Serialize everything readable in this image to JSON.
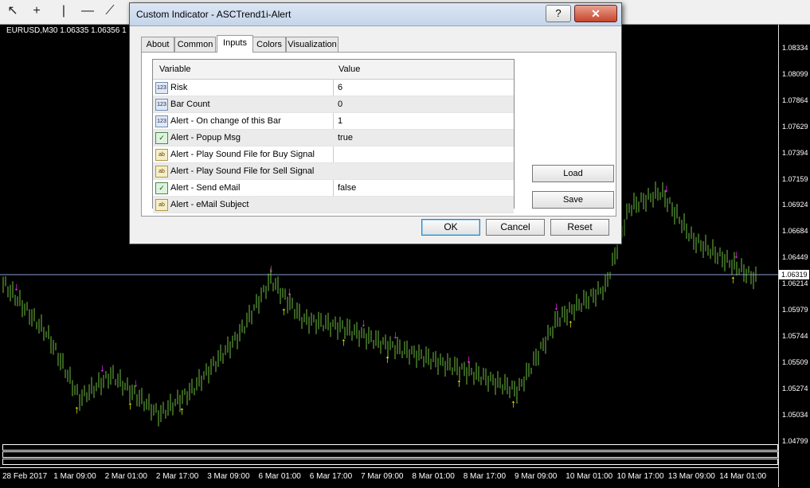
{
  "toolbar": {
    "icons": [
      "cursor-icon",
      "crosshair-icon",
      "vertical-line-icon",
      "horizontal-line-icon",
      "trendline-icon"
    ]
  },
  "chart": {
    "symbol_label": "EURUSD,M30  1.06335 1.06356 1",
    "current_price": "1.06319",
    "price_ticks": [
      "1.08334",
      "1.08099",
      "1.07864",
      "1.07629",
      "1.07394",
      "1.07159",
      "1.06924",
      "1.06684",
      "1.06449",
      "1.06214",
      "1.05979",
      "1.05744",
      "1.05509",
      "1.05274",
      "1.05034",
      "1.04799"
    ],
    "time_labels": [
      "28 Feb 2017",
      "1 Mar 09:00",
      "2 Mar 01:00",
      "2 Mar 17:00",
      "3 Mar 09:00",
      "6 Mar 01:00",
      "6 Mar 17:00",
      "7 Mar 09:00",
      "8 Mar 01:00",
      "8 Mar 17:00",
      "9 Mar 09:00",
      "10 Mar 01:00",
      "10 Mar 17:00",
      "13 Mar 09:00",
      "14 Mar 01:00"
    ],
    "colors": {
      "background": "#000000",
      "candles": "#6fbf3f",
      "buy_arrow": "#ffff00",
      "sell_arrow": "#ff33ff"
    }
  },
  "dialog": {
    "title": "Custom Indicator - ASCTrend1i-Alert",
    "help_label": "?",
    "close_label": "✕",
    "tabs": [
      "About",
      "Common",
      "Inputs",
      "Colors",
      "Visualization"
    ],
    "active_tab": "Inputs",
    "table": {
      "col_variable": "Variable",
      "col_value": "Value",
      "rows": [
        {
          "icon": "123",
          "name": "Risk",
          "value": "6"
        },
        {
          "icon": "123",
          "name": "Bar Count",
          "value": "0"
        },
        {
          "icon": "123",
          "name": "Alert - On change of this Bar",
          "value": "1"
        },
        {
          "icon": "bool",
          "name": "Alert - Popup Msg",
          "value": "true"
        },
        {
          "icon": "ab",
          "name": "Alert - Play Sound File for Buy Signal",
          "value": ""
        },
        {
          "icon": "ab",
          "name": "Alert - Play Sound File for Sell Signal",
          "value": ""
        },
        {
          "icon": "bool",
          "name": "Alert - Send eMail",
          "value": "false"
        },
        {
          "icon": "ab",
          "name": "Alert - eMail Subject",
          "value": ""
        }
      ]
    },
    "load_label": "Load",
    "save_label": "Save",
    "ok_label": "OK",
    "cancel_label": "Cancel",
    "reset_label": "Reset"
  }
}
